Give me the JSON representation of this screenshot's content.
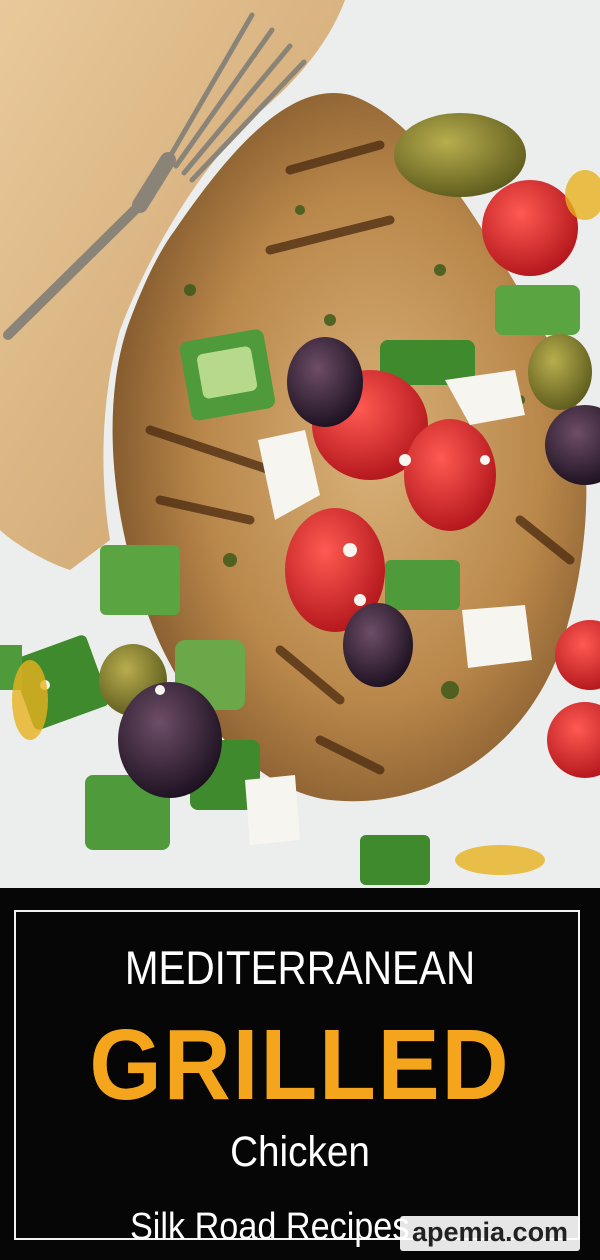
{
  "banner": {
    "line1": "MEDITERRANEAN",
    "line2": "GRILLED",
    "line3": "Chicken",
    "brand": "Silk Road Recipes",
    "watermark": "apemia.com"
  },
  "colors": {
    "accent": "#f5a51b",
    "banner_bg": "#060606",
    "text": "#ffffff"
  }
}
